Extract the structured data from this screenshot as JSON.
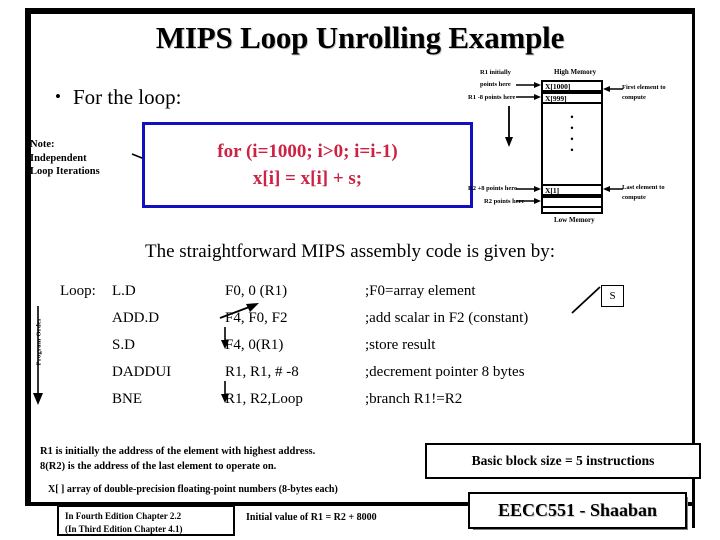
{
  "slide": {
    "title": "MIPS Loop Unrolling Example",
    "bullet_loop": "For the loop:",
    "bullet_marker": "•"
  },
  "note": {
    "line1": "Note:",
    "line2": "Independent",
    "line3": "Loop Iterations"
  },
  "loop_code": {
    "line1": "for (i=1000; i>0; i=i-1)",
    "line2": "x[i] = x[i] + s;",
    "border_color": "#1010c0",
    "text_color": "#cc2244"
  },
  "memory_diagram": {
    "high_memory": "High Memory",
    "low_memory": "Low Memory",
    "r1_initially": "R1 initially",
    "r1_points_here": "points here",
    "r1_minus8": "R1 -8 points here",
    "r2_plus8": "R2 +8 points here",
    "r2_points": "R2 points here",
    "cell_top": "X[1000]",
    "cell_second": "X[999]",
    "cell_bottom": "X[1]",
    "first_element_l1": "First element to",
    "first_element_l2": "compute",
    "last_element_l1": "Last element to",
    "last_element_l2": "compute",
    "vdots": "• • • •"
  },
  "assembly": {
    "heading": "The straightforward MIPS assembly code is given by:",
    "program_order_label": "Program Order",
    "s_box_label": "S",
    "rows": [
      {
        "label": "Loop:",
        "op": "L.D",
        "args": "F0, 0 (R1)",
        "comment": ";F0=array element"
      },
      {
        "label": "",
        "op": "ADD.D",
        "args": "F4, F0, F2",
        "comment": ";add scalar in F2  (constant)"
      },
      {
        "label": "",
        "op": "S.D",
        "args": "F4, 0(R1)",
        "comment": ";store result"
      },
      {
        "label": "",
        "op": "DADDUI",
        "args": "R1, R1, # -8",
        "comment": ";decrement pointer 8 bytes"
      },
      {
        "label": "",
        "op": "BNE",
        "args": "R1, R2,Loop",
        "comment": ";branch R1!=R2"
      }
    ]
  },
  "footer": {
    "note_line1": "R1 is  initially  the address of the element with highest address.",
    "note_line2": "8(R2)   is the address of the last element to operate on.",
    "note_line3": "X[ ]   array of double-precision floating-point numbers (8-bytes each)",
    "basic_block_size": "Basic block size  = 5  instructions",
    "edition_line1": "In Fourth Edition Chapter 2.2",
    "edition_line2": "(In Third Edition Chapter 4.1)",
    "initial_value": "Initial value of R1 =  R2 + 8000",
    "course_tag": "EECC551 - Shaaban"
  }
}
